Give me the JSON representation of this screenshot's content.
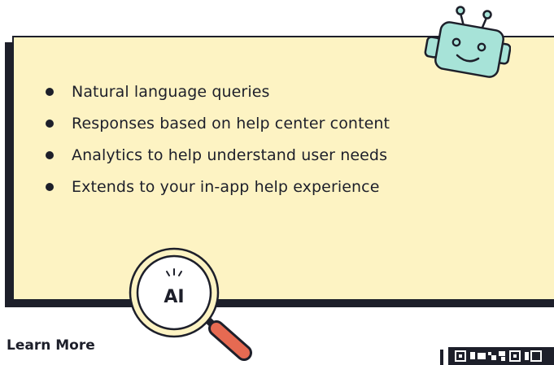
{
  "features": [
    "Natural language queries",
    "Responses based on help center content",
    "Analytics to help understand user needs",
    "Extends to your in-app help experience"
  ],
  "badge": {
    "label": "AI"
  },
  "link": {
    "label": "Learn More"
  },
  "colors": {
    "card": "#fdf3c3",
    "ink": "#1d1f2a",
    "robot": "#a7e3d8",
    "handle": "#e66a52",
    "lens": "#ffffff"
  },
  "icons": {
    "robot": "robot-icon",
    "magnifier": "magnifying-glass-icon",
    "bullet": "bullet-dot"
  }
}
